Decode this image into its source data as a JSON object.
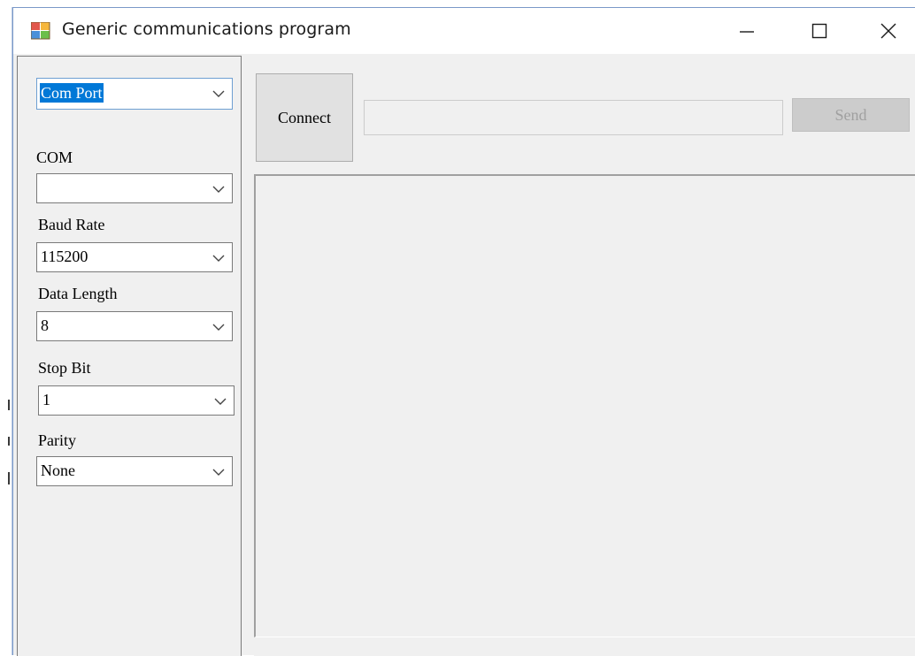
{
  "window": {
    "title": "Generic communications program"
  },
  "titlebar": {
    "minimize_icon": "minimize-icon",
    "maximize_icon": "maximize-icon",
    "close_icon": "close-icon"
  },
  "settings": {
    "mode_selected": "Com Port",
    "com_label": "COM",
    "com_value": "",
    "baud_label": "Baud Rate",
    "baud_value": "115200",
    "data_length_label": "Data Length",
    "data_length_value": "8",
    "stop_bit_label": "Stop Bit",
    "stop_bit_value": "1",
    "parity_label": "Parity",
    "parity_value": "None"
  },
  "toolbar": {
    "connect_label": "Connect",
    "send_input_value": "",
    "send_label": "Send"
  },
  "colors": {
    "selection": "#0078d7",
    "window_bg": "#f0f0f0",
    "disabled_button": "#cccccc"
  }
}
